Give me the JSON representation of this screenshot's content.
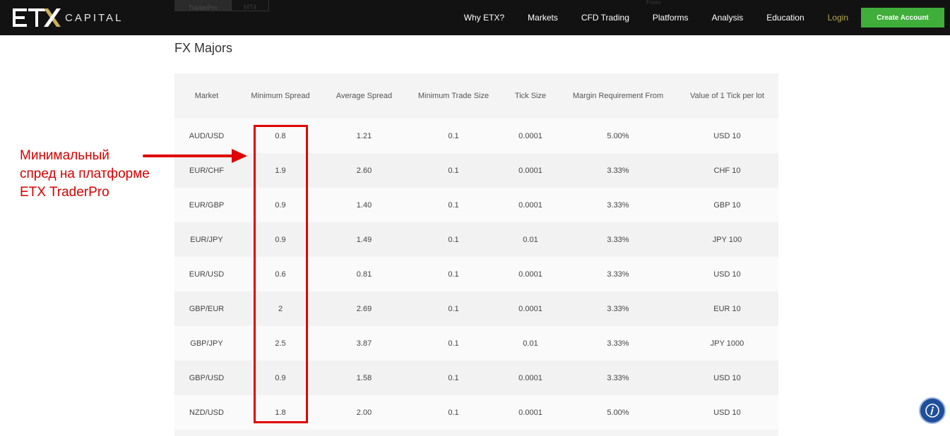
{
  "header": {
    "logo_text": "CAPITAL",
    "tabs": [
      "TraderPro",
      "MT4"
    ],
    "select_stub": "Forex",
    "nav": [
      "Why ETX?",
      "Markets",
      "CFD Trading",
      "Platforms",
      "Analysis",
      "Education"
    ],
    "login_label": "Login",
    "cta_label": "Create Account"
  },
  "section_title": "FX Majors",
  "table": {
    "headers": [
      "Market",
      "Minimum Spread",
      "Average Spread",
      "Minimum Trade Size",
      "Tick Size",
      "Margin Requirement From",
      "Value of 1 Tick per lot"
    ],
    "rows": [
      [
        "AUD/USD",
        "0.8",
        "1.21",
        "0.1",
        "0.0001",
        "5.00%",
        "USD 10"
      ],
      [
        "EUR/CHF",
        "1.9",
        "2.60",
        "0.1",
        "0.0001",
        "3.33%",
        "CHF 10"
      ],
      [
        "EUR/GBP",
        "0.9",
        "1.40",
        "0.1",
        "0.0001",
        "3.33%",
        "GBP 10"
      ],
      [
        "EUR/JPY",
        "0.9",
        "1.49",
        "0.1",
        "0.01",
        "3.33%",
        "JPY 100"
      ],
      [
        "EUR/USD",
        "0.6",
        "0.81",
        "0.1",
        "0.0001",
        "3.33%",
        "USD 10"
      ],
      [
        "GBP/EUR",
        "2",
        "2.69",
        "0.1",
        "0.0001",
        "3.33%",
        "EUR 10"
      ],
      [
        "GBP/JPY",
        "2.5",
        "3.87",
        "0.1",
        "0.01",
        "3.33%",
        "JPY 1000"
      ],
      [
        "GBP/USD",
        "0.9",
        "1.58",
        "0.1",
        "0.0001",
        "3.33%",
        "USD 10"
      ],
      [
        "NZD/USD",
        "1.8",
        "2.00",
        "0.1",
        "0.0001",
        "5.00%",
        "USD 10"
      ]
    ]
  },
  "annotation": {
    "lines": [
      "Минимальный",
      "спред на платформе",
      "ETX TraderPro"
    ],
    "color": "#e00000"
  },
  "colors": {
    "header_bg": "#121212",
    "cta_bg": "#3fae3a",
    "login": "#b4a84e",
    "info_button": "#1f4f9a"
  },
  "icons": {
    "info": "info-icon"
  }
}
